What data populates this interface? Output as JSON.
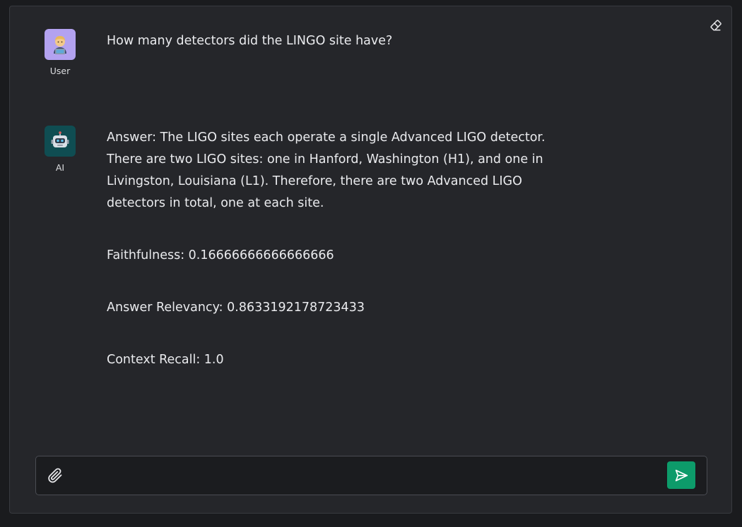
{
  "chat": {
    "messages": [
      {
        "role": "User",
        "avatar": "technologist-emoji-icon",
        "lines": [
          "How many detectors did the LINGO site have?"
        ]
      },
      {
        "role": "AI",
        "avatar": "robot-emoji-icon",
        "lines": [
          "Answer: The LIGO sites each operate a single Advanced LIGO detector. There are two LIGO sites: one in Hanford, Washington (H1), and one in Livingston, Louisiana (L1). Therefore, there are two Advanced LIGO detectors in total, one at each site.",
          "Faithfulness: 0.16666666666666666",
          "Answer Relevancy: 0.8633192178723433",
          "Context Recall: 1.0"
        ]
      }
    ]
  },
  "toolbar": {
    "clear_icon": "eraser-icon"
  },
  "composer": {
    "value": "",
    "placeholder": "",
    "attach_icon": "paperclip-icon",
    "send_icon": "send-icon"
  },
  "colors": {
    "background": "#1a1b1e",
    "panel": "#25262a",
    "send_button": "#0d9b6a",
    "user_avatar": "#b3a2f0",
    "ai_avatar": "#0f4d52"
  }
}
